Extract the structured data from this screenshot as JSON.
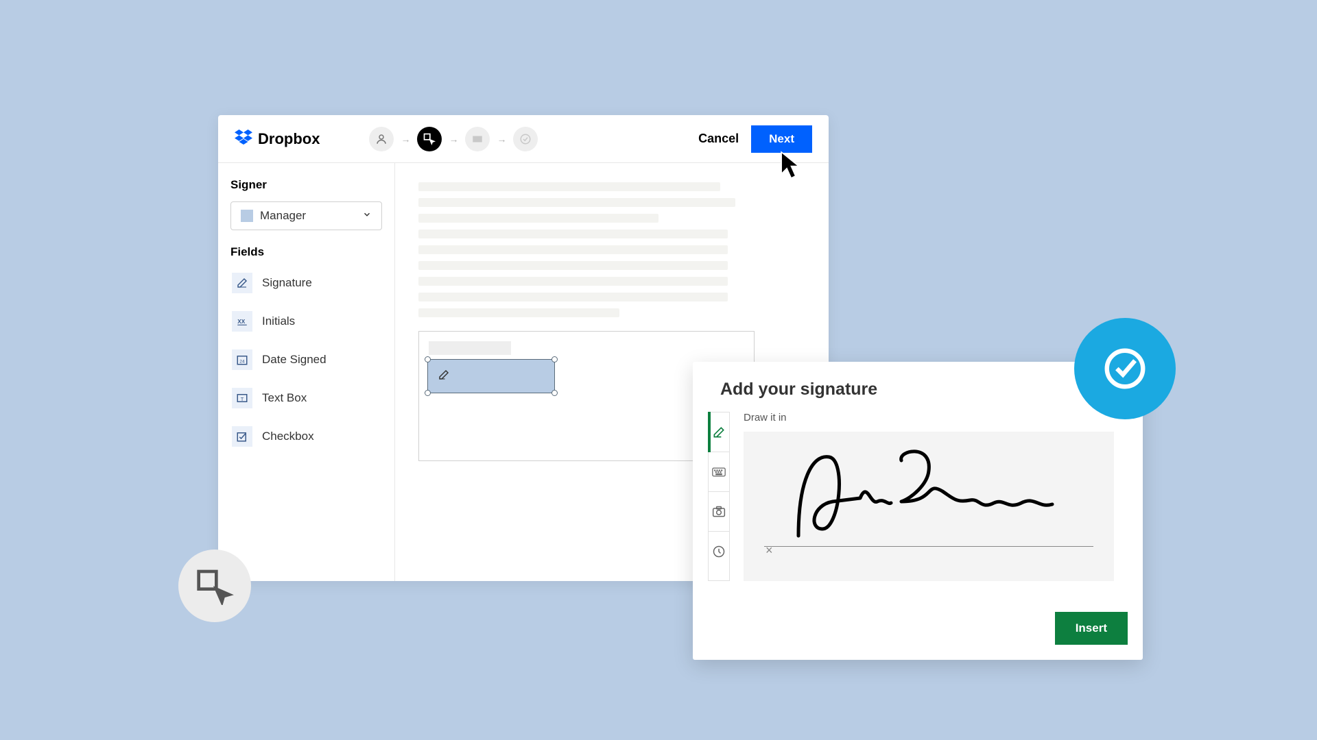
{
  "brand": {
    "name": "Dropbox"
  },
  "header": {
    "cancel_label": "Cancel",
    "next_label": "Next"
  },
  "sidebar": {
    "signer_label": "Signer",
    "signer_selected": "Manager",
    "fields_label": "Fields",
    "fields": [
      {
        "label": "Signature",
        "icon": "pencil-icon"
      },
      {
        "label": "Initials",
        "icon": "initials-icon"
      },
      {
        "label": "Date Signed",
        "icon": "calendar-icon"
      },
      {
        "label": "Text Box",
        "icon": "textbox-icon"
      },
      {
        "label": "Checkbox",
        "icon": "checkbox-icon"
      }
    ]
  },
  "signature_dialog": {
    "title": "Add your signature",
    "draw_label": "Draw it in",
    "insert_label": "Insert",
    "clear_symbol": "×"
  },
  "colors": {
    "primary_blue": "#0061fe",
    "accent_green": "#0d7f3f",
    "badge_cyan": "#1ba9e1",
    "bg_blue": "#b8cce4"
  }
}
